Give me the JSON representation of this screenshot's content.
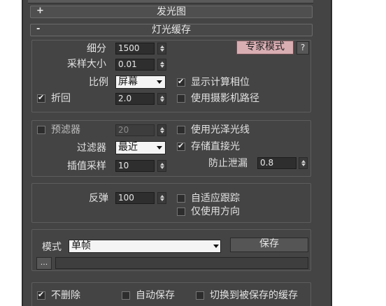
{
  "rollouts": {
    "glow_title": "发光图",
    "glow_sign": "+",
    "cache_title": "灯光缓存",
    "cache_sign": "-"
  },
  "calc_params": {
    "subdivs_label": "细分",
    "subdivs_value": "1500",
    "sample_size_label": "采样大小",
    "sample_size_value": "0.01",
    "scale_label": "比例",
    "scale_value": "屏幕",
    "expert_button": "专家模式",
    "help_button": "?",
    "show_calc_phase_label": "显示计算相位",
    "show_calc_phase_checked": true,
    "use_camera_path_label": "使用摄影机路径",
    "use_camera_path_checked": false,
    "retrace_label": "折回",
    "retrace_checked": true,
    "retrace_value": "2.0"
  },
  "reconstruction": {
    "prefilter_label": "预滤器",
    "prefilter_checked": false,
    "prefilter_value": "20",
    "use_glossy_rays_label": "使用光泽光线",
    "use_glossy_rays_checked": false,
    "filter_label": "过滤器",
    "filter_value": "最近",
    "store_direct_label": "存储直接光",
    "store_direct_checked": true,
    "interp_samples_label": "插值采样",
    "interp_samples_value": "10",
    "leak_prevention_label": "防止泄漏",
    "leak_prevention_value": "0.8"
  },
  "bounce": {
    "bounces_label": "反弹",
    "bounces_value": "100",
    "adaptive_tracing_label": "自适应跟踪",
    "adaptive_tracing_checked": false,
    "directions_only_label": "仅使用方向",
    "directions_only_checked": false
  },
  "mode": {
    "mode_label": "模式",
    "mode_value": "单帧",
    "save_button": "保存",
    "browse_button": "...",
    "file_path": ""
  },
  "on_render_end": {
    "dont_delete_label": "不删除",
    "dont_delete_checked": true,
    "auto_save_label": "自动保存",
    "auto_save_checked": false,
    "switch_to_saved_label": "切换到被保存的缓存",
    "switch_to_saved_checked": false
  }
}
